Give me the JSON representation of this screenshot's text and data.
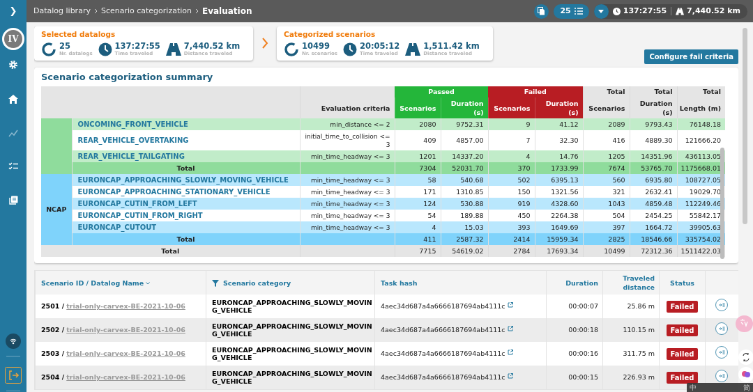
{
  "breadcrumb": [
    "Datalog library",
    "Scenario categorization",
    "Evaluation"
  ],
  "topbar": {
    "count": "25",
    "time": "137:27:55",
    "distance": "7,440.52 km"
  },
  "sidebar": {
    "toggle": "❯",
    "avatar": "IV"
  },
  "cards": [
    {
      "title": "Selected datalogs",
      "stats": [
        {
          "kind": "count",
          "value": "25",
          "label": "Nr. datalogs"
        },
        {
          "kind": "time",
          "value": "137:27:55",
          "label": "Time traveled"
        },
        {
          "kind": "distance",
          "value": "7,440.52 km",
          "label": "Distance traveled"
        }
      ]
    },
    {
      "title": "Categorized scenarios",
      "stats": [
        {
          "kind": "count",
          "value": "10499",
          "label": "Nr. scenarios"
        },
        {
          "kind": "time",
          "value": "20:05:12",
          "label": "Time traveled"
        },
        {
          "kind": "distance",
          "value": "1,511.42 km",
          "label": "Distance traveled"
        }
      ]
    }
  ],
  "configure_button": "Configure fail criteria",
  "summary": {
    "title": "Scenario categorization summary",
    "header": {
      "criteria": "Evaluation criteria",
      "passed": "Passed",
      "failed": "Failed",
      "sub": [
        "Scenarios",
        "Duration (s)",
        "Scenarios",
        "Duration (s)"
      ],
      "totals": [
        [
          "Total",
          "Scenarios"
        ],
        [
          "Total",
          "Duration (s)"
        ],
        [
          "Total",
          "Length (m)"
        ]
      ]
    },
    "groups": [
      {
        "color": "#8fdc9c",
        "rows": [
          {
            "kind": "scenario",
            "name": "ONCOMING_FRONT_VEHICLE",
            "criteria": "min_distance <= 2",
            "values": [
              "2080",
              "9752.31",
              "9",
              "41.12",
              "2089",
              "9793.43",
              "76148.18"
            ]
          },
          {
            "kind": "scenario",
            "name": "REAR_VEHICLE_OVERTAKING",
            "criteria": "initial_time_to_collision <= 3",
            "values": [
              "409",
              "4857.00",
              "7",
              "32.30",
              "416",
              "4889.30",
              "121666.20"
            ]
          },
          {
            "kind": "scenario",
            "name": "REAR_VEHICLE_TAILGATING",
            "criteria": "min_time_headway <= 3",
            "values": [
              "1201",
              "14337.20",
              "4",
              "14.76",
              "1205",
              "14351.96",
              "436113.05"
            ]
          },
          {
            "kind": "subtotal",
            "name": "Total",
            "values": [
              "7304",
              "52031.70",
              "370",
              "1733.99",
              "7674",
              "53765.70",
              "1175668.01"
            ]
          }
        ]
      },
      {
        "label": "NCAP",
        "color": "#7fd3fb",
        "rows": [
          {
            "kind": "scenario",
            "name": "EURONCAP_APPROACHING_SLOWLY_MOVING_VEHICLE",
            "criteria": "min_time_headway <= 3",
            "values": [
              "58",
              "540.68",
              "502",
              "6395.13",
              "560",
              "6935.80",
              "108727.05"
            ]
          },
          {
            "kind": "scenario",
            "name": "EURONCAP_APPROACHING_STATIONARY_VEHICLE",
            "criteria": "min_time_headway <= 3",
            "values": [
              "171",
              "1310.85",
              "150",
              "1321.56",
              "321",
              "2632.41",
              "19029.70"
            ]
          },
          {
            "kind": "scenario",
            "name": "EURONCAP_CUTIN_FROM_LEFT",
            "criteria": "min_time_headway <= 3",
            "values": [
              "124",
              "530.88",
              "919",
              "4328.60",
              "1043",
              "4859.48",
              "112249.46"
            ]
          },
          {
            "kind": "scenario",
            "name": "EURONCAP_CUTIN_FROM_RIGHT",
            "criteria": "min_time_headway <= 3",
            "values": [
              "54",
              "189.88",
              "450",
              "2264.38",
              "504",
              "2454.25",
              "55842.17"
            ]
          },
          {
            "kind": "scenario",
            "name": "EURONCAP_CUTOUT",
            "criteria": "min_time_headway <= 3",
            "values": [
              "4",
              "15.03",
              "393",
              "1649.69",
              "397",
              "1664.72",
              "39905.63"
            ]
          },
          {
            "kind": "subtotal",
            "name": "Total",
            "values": [
              "411",
              "2587.32",
              "2414",
              "15959.34",
              "2825",
              "18546.66",
              "335754.02"
            ]
          }
        ]
      }
    ],
    "total": {
      "name": "Total",
      "values": [
        "7715",
        "54619.02",
        "2784",
        "17693.34",
        "10499",
        "72312.36",
        "1511422.03"
      ]
    }
  },
  "results": {
    "columns": [
      "Scenario ID / Datalog Name",
      "Scenario category",
      "Task hash",
      "Duration",
      "Traveled distance",
      "Status"
    ],
    "rows": [
      {
        "id": "2501 /",
        "datalog": "trial-only-carvex-BE-2021-10-06",
        "category": "EURONCAP_APPROACHING_SLOWLY_MOVING_VEHICLE",
        "hash": "4aec34d687a4a6666187694ab4111c",
        "duration": "00:00:07",
        "distance": "25.86 m",
        "status": "Failed"
      },
      {
        "id": "2502 /",
        "datalog": "trial-only-carvex-BE-2021-10-06",
        "category": "EURONCAP_APPROACHING_SLOWLY_MOVING_VEHICLE",
        "hash": "4aec34d687a4a6666187694ab4111c",
        "duration": "00:00:18",
        "distance": "110.15 m",
        "status": "Failed"
      },
      {
        "id": "2503 /",
        "datalog": "trial-only-carvex-BE-2021-10-06",
        "category": "EURONCAP_APPROACHING_SLOWLY_MOVING_VEHICLE",
        "hash": "4aec34d687a4a6666187694ab4111c",
        "duration": "00:00:16",
        "distance": "311.75 m",
        "status": "Failed"
      },
      {
        "id": "2504 /",
        "datalog": "trial-only-carvex-BE-2021-10-06",
        "category": "EURONCAP_APPROACHING_SLOWLY_MOVING_VEHICLE",
        "hash": "4aec34d687a4a6666187694ab4111c",
        "duration": "00:00:15",
        "distance": "226.93 m",
        "status": "Failed"
      }
    ]
  },
  "ime_bar": [
    "中",
    "简"
  ]
}
